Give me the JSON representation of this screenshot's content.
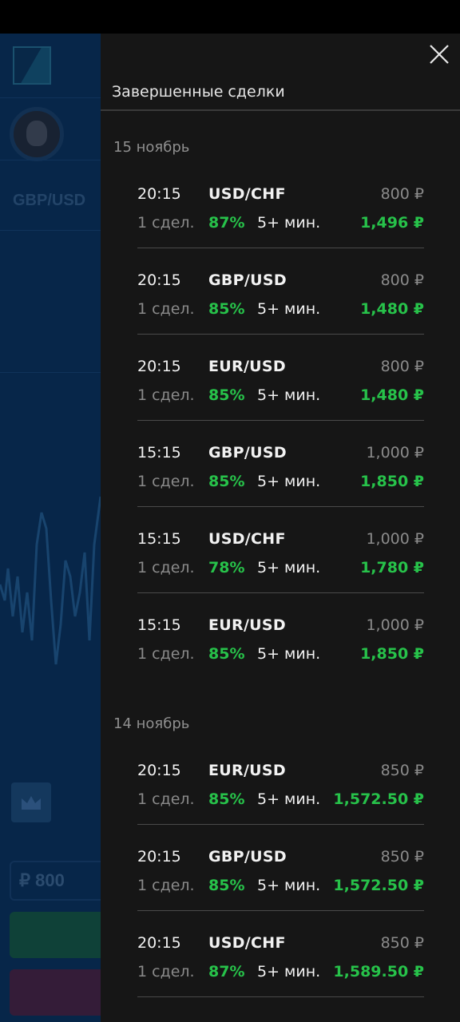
{
  "background": {
    "pair": "GBP/USD",
    "amount": "₽ 800"
  },
  "drawer": {
    "title": "Завершенные сделки",
    "close_icon": "close-icon",
    "groups": [
      {
        "date": "15 ноябрь",
        "deals": [
          {
            "time": "20:15",
            "pair": "USD/CHF",
            "amount": "800 ₽",
            "count": "1 сдел.",
            "percent": "87%",
            "duration": "5+ мин.",
            "payout": "1,496 ₽"
          },
          {
            "time": "20:15",
            "pair": "GBP/USD",
            "amount": "800 ₽",
            "count": "1 сдел.",
            "percent": "85%",
            "duration": "5+ мин.",
            "payout": "1,480 ₽"
          },
          {
            "time": "20:15",
            "pair": "EUR/USD",
            "amount": "800 ₽",
            "count": "1 сдел.",
            "percent": "85%",
            "duration": "5+ мин.",
            "payout": "1,480 ₽"
          },
          {
            "time": "15:15",
            "pair": "GBP/USD",
            "amount": "1,000 ₽",
            "count": "1 сдел.",
            "percent": "85%",
            "duration": "5+ мин.",
            "payout": "1,850 ₽"
          },
          {
            "time": "15:15",
            "pair": "USD/CHF",
            "amount": "1,000 ₽",
            "count": "1 сдел.",
            "percent": "78%",
            "duration": "5+ мин.",
            "payout": "1,780 ₽"
          },
          {
            "time": "15:15",
            "pair": "EUR/USD",
            "amount": "1,000 ₽",
            "count": "1 сдел.",
            "percent": "85%",
            "duration": "5+ мин.",
            "payout": "1,850 ₽"
          }
        ]
      },
      {
        "date": "14 ноябрь",
        "deals": [
          {
            "time": "20:15",
            "pair": "EUR/USD",
            "amount": "850 ₽",
            "count": "1 сдел.",
            "percent": "85%",
            "duration": "5+ мин.",
            "payout": "1,572.50 ₽"
          },
          {
            "time": "20:15",
            "pair": "GBP/USD",
            "amount": "850 ₽",
            "count": "1 сдел.",
            "percent": "85%",
            "duration": "5+ мин.",
            "payout": "1,572.50 ₽"
          },
          {
            "time": "20:15",
            "pair": "USD/CHF",
            "amount": "850 ₽",
            "count": "1 сдел.",
            "percent": "87%",
            "duration": "5+ мин.",
            "payout": "1,589.50 ₽"
          }
        ]
      }
    ]
  },
  "colors": {
    "drawer_bg": "#161616",
    "profit_green": "#27c24a",
    "app_bg": "#0d3c68"
  }
}
